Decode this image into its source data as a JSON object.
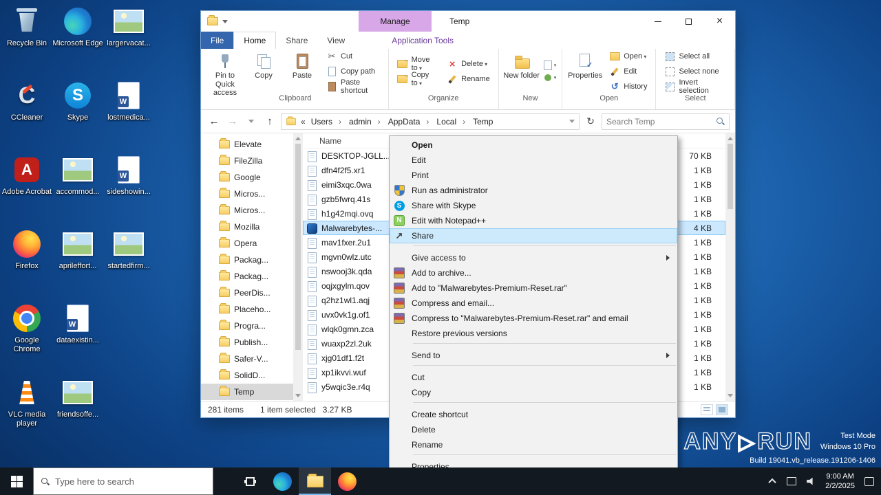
{
  "colors": {
    "accent": "#0078d7",
    "selection_highlight": "#cce8ff",
    "manage_tab": "#d8a7e8",
    "file_tab": "#3466ad",
    "taskbar": "#131920"
  },
  "desktop": {
    "icons": [
      {
        "label": "Recycle Bin",
        "icon": "recycle-bin"
      },
      {
        "label": "CCleaner",
        "icon": "ccleaner"
      },
      {
        "label": "Adobe Acrobat",
        "icon": "acrobat"
      },
      {
        "label": "Firefox",
        "icon": "firefox"
      },
      {
        "label": "Google Chrome",
        "icon": "chrome"
      },
      {
        "label": "VLC media player",
        "icon": "vlc"
      },
      {
        "label": "Microsoft Edge",
        "icon": "edge"
      },
      {
        "label": "Skype",
        "icon": "skype"
      },
      {
        "label": "accommod...",
        "icon": "image-doc"
      },
      {
        "label": "aprileffort...",
        "icon": "image-doc"
      },
      {
        "label": "dataexistin...",
        "icon": "word-doc"
      },
      {
        "label": "friendsoffe...",
        "icon": "image-doc"
      },
      {
        "label": "largervacat...",
        "icon": "image-doc"
      },
      {
        "label": "lostmedica...",
        "icon": "word-doc"
      },
      {
        "label": "sideshowin...",
        "icon": "word-doc"
      },
      {
        "label": "startedfirm...",
        "icon": "image-doc"
      }
    ]
  },
  "explorer": {
    "window_title": "Temp",
    "contextual_tab": "Manage",
    "tabs": [
      {
        "label": "File",
        "style": "file"
      },
      {
        "label": "Home",
        "style": "active"
      },
      {
        "label": "Share"
      },
      {
        "label": "View"
      },
      {
        "label": "Application Tools",
        "style": "apptools"
      }
    ],
    "ribbon": {
      "clipboard": {
        "label": "Clipboard",
        "big": [
          {
            "label": "Pin to Quick access",
            "icon": "pin"
          },
          {
            "label": "Copy",
            "icon": "copy"
          },
          {
            "label": "Paste",
            "icon": "paste"
          }
        ],
        "small": [
          {
            "label": "Cut",
            "icon": "cut"
          },
          {
            "label": "Copy path",
            "icon": "copy-path"
          },
          {
            "label": "Paste shortcut",
            "icon": "paste-shortcut"
          }
        ]
      },
      "organize": {
        "label": "Organize",
        "col1": [
          {
            "label": "Move to",
            "icon": "move-to",
            "dropdown": true
          },
          {
            "label": "Copy to",
            "icon": "copy-to",
            "dropdown": true
          }
        ],
        "col2": [
          {
            "label": "Delete",
            "icon": "delete",
            "dropdown": true
          },
          {
            "label": "Rename",
            "icon": "rename"
          }
        ]
      },
      "new_group": {
        "label": "New",
        "big": [
          {
            "label": "New folder",
            "icon": "new-folder"
          }
        ],
        "stack": [
          {
            "icon": "new-item",
            "dropdown": true
          },
          {
            "icon": "easy-access",
            "dropdown": true
          }
        ]
      },
      "open_group": {
        "label": "Open",
        "big": [
          {
            "label": "Properties",
            "icon": "properties"
          }
        ],
        "small": [
          {
            "label": "Open",
            "icon": "open",
            "dropdown": true
          },
          {
            "label": "Edit",
            "icon": "edit"
          },
          {
            "label": "History",
            "icon": "history"
          }
        ]
      },
      "select_group": {
        "label": "Select",
        "small": [
          {
            "label": "Select all",
            "icon": "select-all"
          },
          {
            "label": "Select none",
            "icon": "select-none"
          },
          {
            "label": "Invert selection",
            "icon": "invert-selection"
          }
        ]
      }
    },
    "address": {
      "prefix": "«",
      "crumbs": [
        "Users",
        "admin",
        "AppData",
        "Local",
        "Temp"
      ]
    },
    "search_placeholder": "Search Temp",
    "tree": [
      {
        "name": "Elevate"
      },
      {
        "name": "FileZilla"
      },
      {
        "name": "Google"
      },
      {
        "name": "Micros..."
      },
      {
        "name": "Micros..."
      },
      {
        "name": "Mozilla"
      },
      {
        "name": "Opera"
      },
      {
        "name": "Packag..."
      },
      {
        "name": "Packag..."
      },
      {
        "name": "PeerDis..."
      },
      {
        "name": "Placeho..."
      },
      {
        "name": "Progra..."
      },
      {
        "name": "Publish..."
      },
      {
        "name": "Safer-V..."
      },
      {
        "name": "SolidD..."
      },
      {
        "name": "Temp",
        "selected": true
      }
    ],
    "list_header": "Name",
    "files": [
      {
        "name": "DESKTOP-JGLL...",
        "size": "70 KB",
        "icon": "doc"
      },
      {
        "name": "dfn4f2f5.xr1",
        "size": "1 KB",
        "icon": "doc"
      },
      {
        "name": "eimi3xqc.0wa",
        "size": "1 KB",
        "icon": "doc"
      },
      {
        "name": "gzb5fwrq.41s",
        "size": "1 KB",
        "icon": "doc"
      },
      {
        "name": "h1g42mqi.ovq",
        "size": "1 KB",
        "icon": "doc"
      },
      {
        "name": "Malwarebytes-...",
        "size": "4 KB",
        "icon": "app",
        "selected": true
      },
      {
        "name": "mav1fxer.2u1",
        "size": "1 KB",
        "icon": "doc"
      },
      {
        "name": "mgvn0wlz.utc",
        "size": "1 KB",
        "icon": "doc"
      },
      {
        "name": "nswooj3k.qda",
        "size": "1 KB",
        "icon": "doc"
      },
      {
        "name": "oqjxgylm.qov",
        "size": "1 KB",
        "icon": "doc"
      },
      {
        "name": "q2hz1wl1.aqj",
        "size": "1 KB",
        "icon": "doc"
      },
      {
        "name": "uvx0vk1g.of1",
        "size": "1 KB",
        "icon": "doc"
      },
      {
        "name": "wlqk0gmn.zca",
        "size": "1 KB",
        "icon": "doc"
      },
      {
        "name": "wuaxp2zl.2uk",
        "size": "1 KB",
        "icon": "doc"
      },
      {
        "name": "xjg01df1.f2t",
        "size": "1 KB",
        "icon": "doc"
      },
      {
        "name": "xp1ikvvi.wuf",
        "size": "1 KB",
        "icon": "doc"
      },
      {
        "name": "y5wqic3e.r4q",
        "size": "1 KB",
        "icon": "doc"
      }
    ],
    "status": {
      "items": "281 items",
      "selected": "1 item selected",
      "size": "3.27 KB"
    }
  },
  "context_menu": {
    "items": [
      {
        "label": "Open",
        "bold": true
      },
      {
        "label": "Edit"
      },
      {
        "label": "Print"
      },
      {
        "label": "Run as administrator",
        "icon": "uac-shield"
      },
      {
        "label": "Share with Skype",
        "icon": "skype"
      },
      {
        "label": "Edit with Notepad++",
        "icon": "notepadpp"
      },
      {
        "label": "Share",
        "icon": "share",
        "highlighted": true
      },
      {
        "separator": true
      },
      {
        "label": "Give access to",
        "submenu": true
      },
      {
        "label": "Add to archive...",
        "icon": "winrar"
      },
      {
        "label": "Add to \"Malwarebytes-Premium-Reset.rar\"",
        "icon": "winrar"
      },
      {
        "label": "Compress and email...",
        "icon": "winrar"
      },
      {
        "label": "Compress to \"Malwarebytes-Premium-Reset.rar\" and email",
        "icon": "winrar"
      },
      {
        "label": "Restore previous versions"
      },
      {
        "separator": true
      },
      {
        "label": "Send to",
        "submenu": true
      },
      {
        "separator": true
      },
      {
        "label": "Cut"
      },
      {
        "label": "Copy"
      },
      {
        "separator": true
      },
      {
        "label": "Create shortcut"
      },
      {
        "label": "Delete"
      },
      {
        "label": "Rename"
      },
      {
        "separator": true
      },
      {
        "label": "Properties"
      }
    ]
  },
  "taskbar": {
    "search_placeholder": "Type here to search",
    "clock": {
      "time": "9:00 AM",
      "date": "2/2/2025"
    }
  },
  "watermark": {
    "logo_left": "ANY",
    "logo_right": "RUN",
    "line1": "Test Mode",
    "line2": "Windows 10 Pro",
    "line3": "Build 19041.vb_release.191206-1406"
  }
}
